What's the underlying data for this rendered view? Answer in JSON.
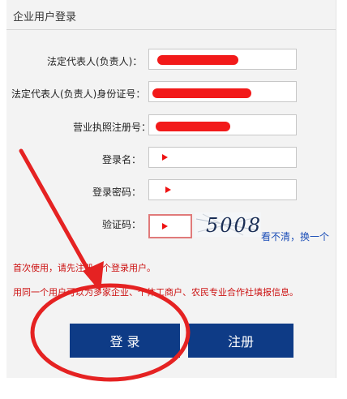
{
  "panel": {
    "title": "企业用户登录"
  },
  "form": {
    "legal_rep_label": "法定代表人(负责人)：",
    "legal_rep_id_label": "法定代表人(负责人)身份证号：",
    "license_no_label": "营业执照注册号：",
    "username_label": "登录名：",
    "password_label": "登录密码：",
    "captcha_label": "验证码：",
    "captcha_text": "5008",
    "captcha_refresh": "看不清，换一个"
  },
  "notices": {
    "first_use": "首次使用，请先注册一个登录用户。",
    "multi_enterprise": "用同一个用户可以为多家企业、个体工商户、农民专业合作社填报信息。"
  },
  "buttons": {
    "login": "登 录",
    "register": "注册"
  },
  "colors": {
    "accent": "#0e3b86",
    "warning": "#cc1111",
    "annotation": "#e52222"
  }
}
